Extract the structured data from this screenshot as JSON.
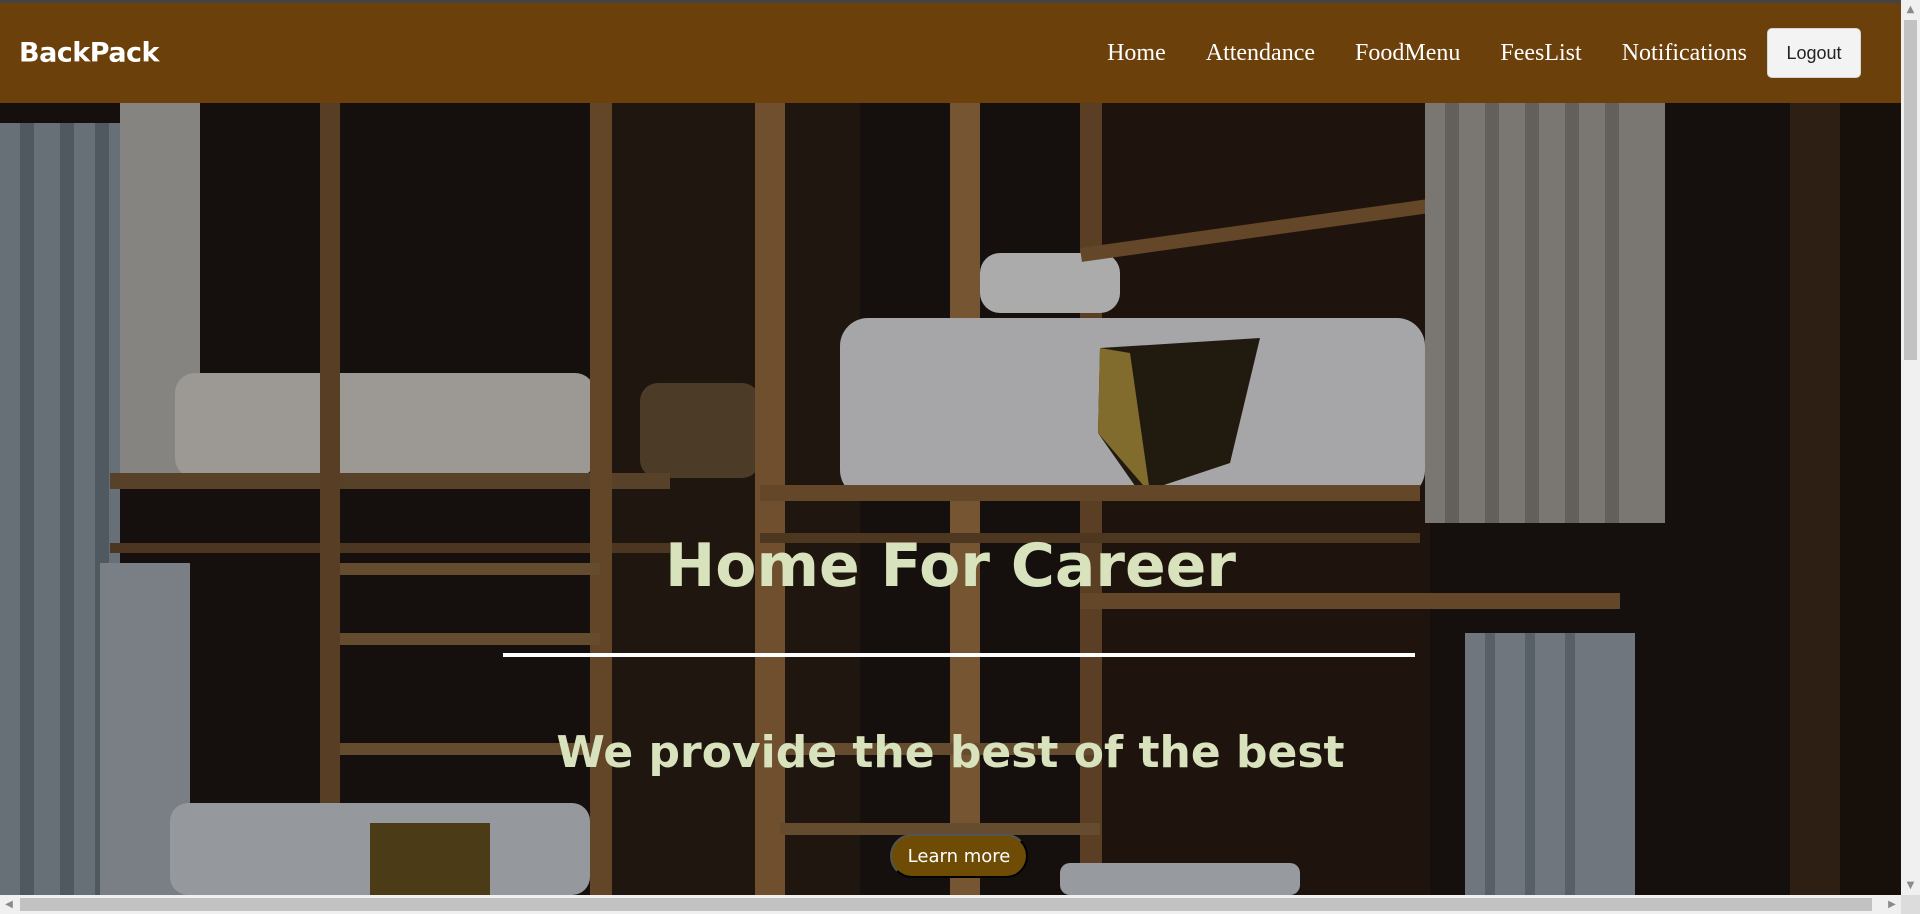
{
  "brand": {
    "name": "BackPack"
  },
  "nav": {
    "links": [
      "Home",
      "Attendance",
      "FoodMenu",
      "FeesList",
      "Notifications"
    ],
    "logout_label": "Logout"
  },
  "hero": {
    "title": "Home For Career",
    "subtitle": "We provide the best of the best",
    "cta_label": "Learn more"
  },
  "colors": {
    "navbar": "#6b400b",
    "hero_text": "#d8e2bd",
    "cta_background": "#6e4c05"
  }
}
